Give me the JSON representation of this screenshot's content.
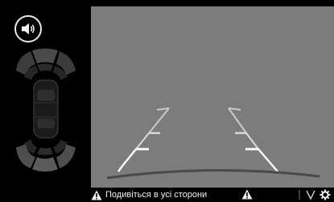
{
  "camera": {
    "warning_text": "Подивіться в усі сторони"
  },
  "icons": {
    "volume": "speaker-icon",
    "warning": "warning-triangle-icon",
    "view_mode": "guideline-toggle-icon",
    "settings": "gear-icon"
  },
  "colors": {
    "camera_bg": "#7c7c7c",
    "guideline_white": "#ffffff",
    "sensor_inactive": "#3a3a3a"
  }
}
